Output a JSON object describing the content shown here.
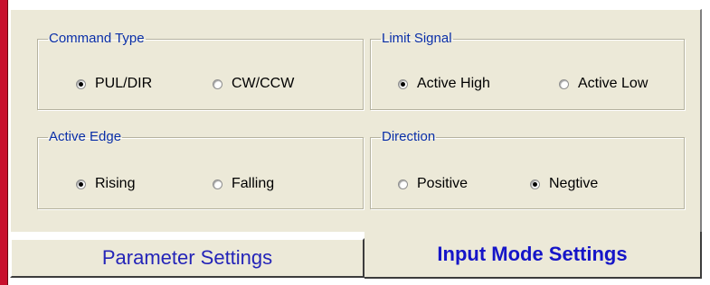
{
  "groups": {
    "command_type": {
      "title": "Command Type",
      "options": [
        {
          "label": "PUL/DIR",
          "checked": true
        },
        {
          "label": "CW/CCW",
          "checked": false
        }
      ]
    },
    "limit_signal": {
      "title": "Limit Signal",
      "options": [
        {
          "label": "Active High",
          "checked": true
        },
        {
          "label": "Active Low",
          "checked": false
        }
      ]
    },
    "active_edge": {
      "title": "Active Edge",
      "options": [
        {
          "label": "Rising",
          "checked": true
        },
        {
          "label": "Falling",
          "checked": false
        }
      ]
    },
    "direction": {
      "title": "Direction",
      "options": [
        {
          "label": "Positive",
          "checked": false
        },
        {
          "label": "Negtive",
          "checked": true
        }
      ]
    }
  },
  "tabs": [
    {
      "label": "Parameter Settings",
      "active": false
    },
    {
      "label": "Input Mode Settings",
      "active": true
    }
  ],
  "colors": {
    "legend_text": "#0a2fa8",
    "tab_text": "#2424b8",
    "panel_bg": "#ece9d8",
    "left_edge": "#c8102e"
  }
}
